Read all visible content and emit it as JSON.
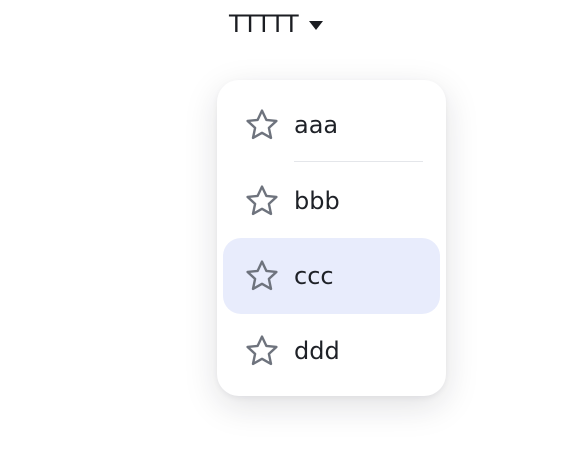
{
  "dropdown": {
    "trigger_label": "TTTTT",
    "caret_icon": "caret-down-icon",
    "items": [
      {
        "label": "aaa",
        "icon": "star-outline-icon",
        "active": false
      },
      {
        "label": "bbb",
        "icon": "star-outline-icon",
        "active": false
      },
      {
        "label": "ccc",
        "icon": "star-outline-icon",
        "active": true
      },
      {
        "label": "ddd",
        "icon": "star-outline-icon",
        "active": false
      }
    ]
  },
  "colors": {
    "text": "#1b1d22",
    "icon_stroke": "#6e737d",
    "active_bg": "#e8ecfc",
    "divider": "#e4e6ea"
  }
}
